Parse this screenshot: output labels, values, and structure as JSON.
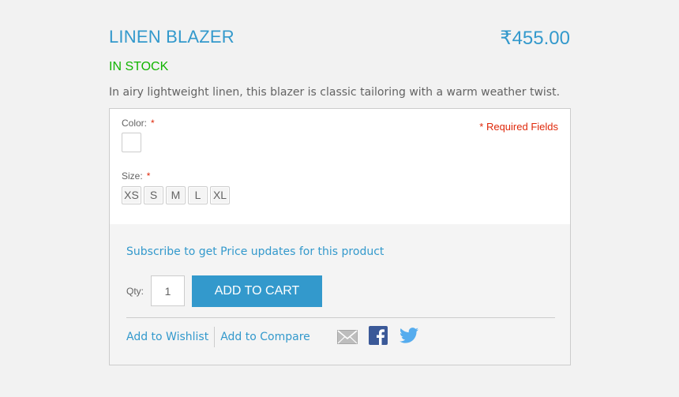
{
  "product": {
    "title": "LINEN BLAZER",
    "price": "₹455.00",
    "stock": "IN STOCK",
    "description": "In airy lightweight linen, this blazer is classic tailoring with a warm weather twist."
  },
  "options": {
    "required_fields": "* Required Fields",
    "color_label": "Color:",
    "size_label": "Size:",
    "required_star": "*",
    "sizes": [
      "XS",
      "S",
      "M",
      "L",
      "XL"
    ]
  },
  "cart": {
    "subscribe_text": "Subscribe to get Price updates for this product",
    "qty_label": "Qty:",
    "qty_value": "1",
    "add_to_cart_label": "ADD TO CART",
    "wishlist_label": "Add to Wishlist",
    "compare_label": "Add to Compare"
  },
  "icons": {
    "mail": "mail-icon",
    "facebook": "facebook-icon",
    "twitter": "twitter-icon"
  },
  "colors": {
    "accent": "#3399cc",
    "in_stock": "#11b400",
    "required": "#df280a",
    "facebook": "#3b5998",
    "twitter": "#55acee"
  }
}
